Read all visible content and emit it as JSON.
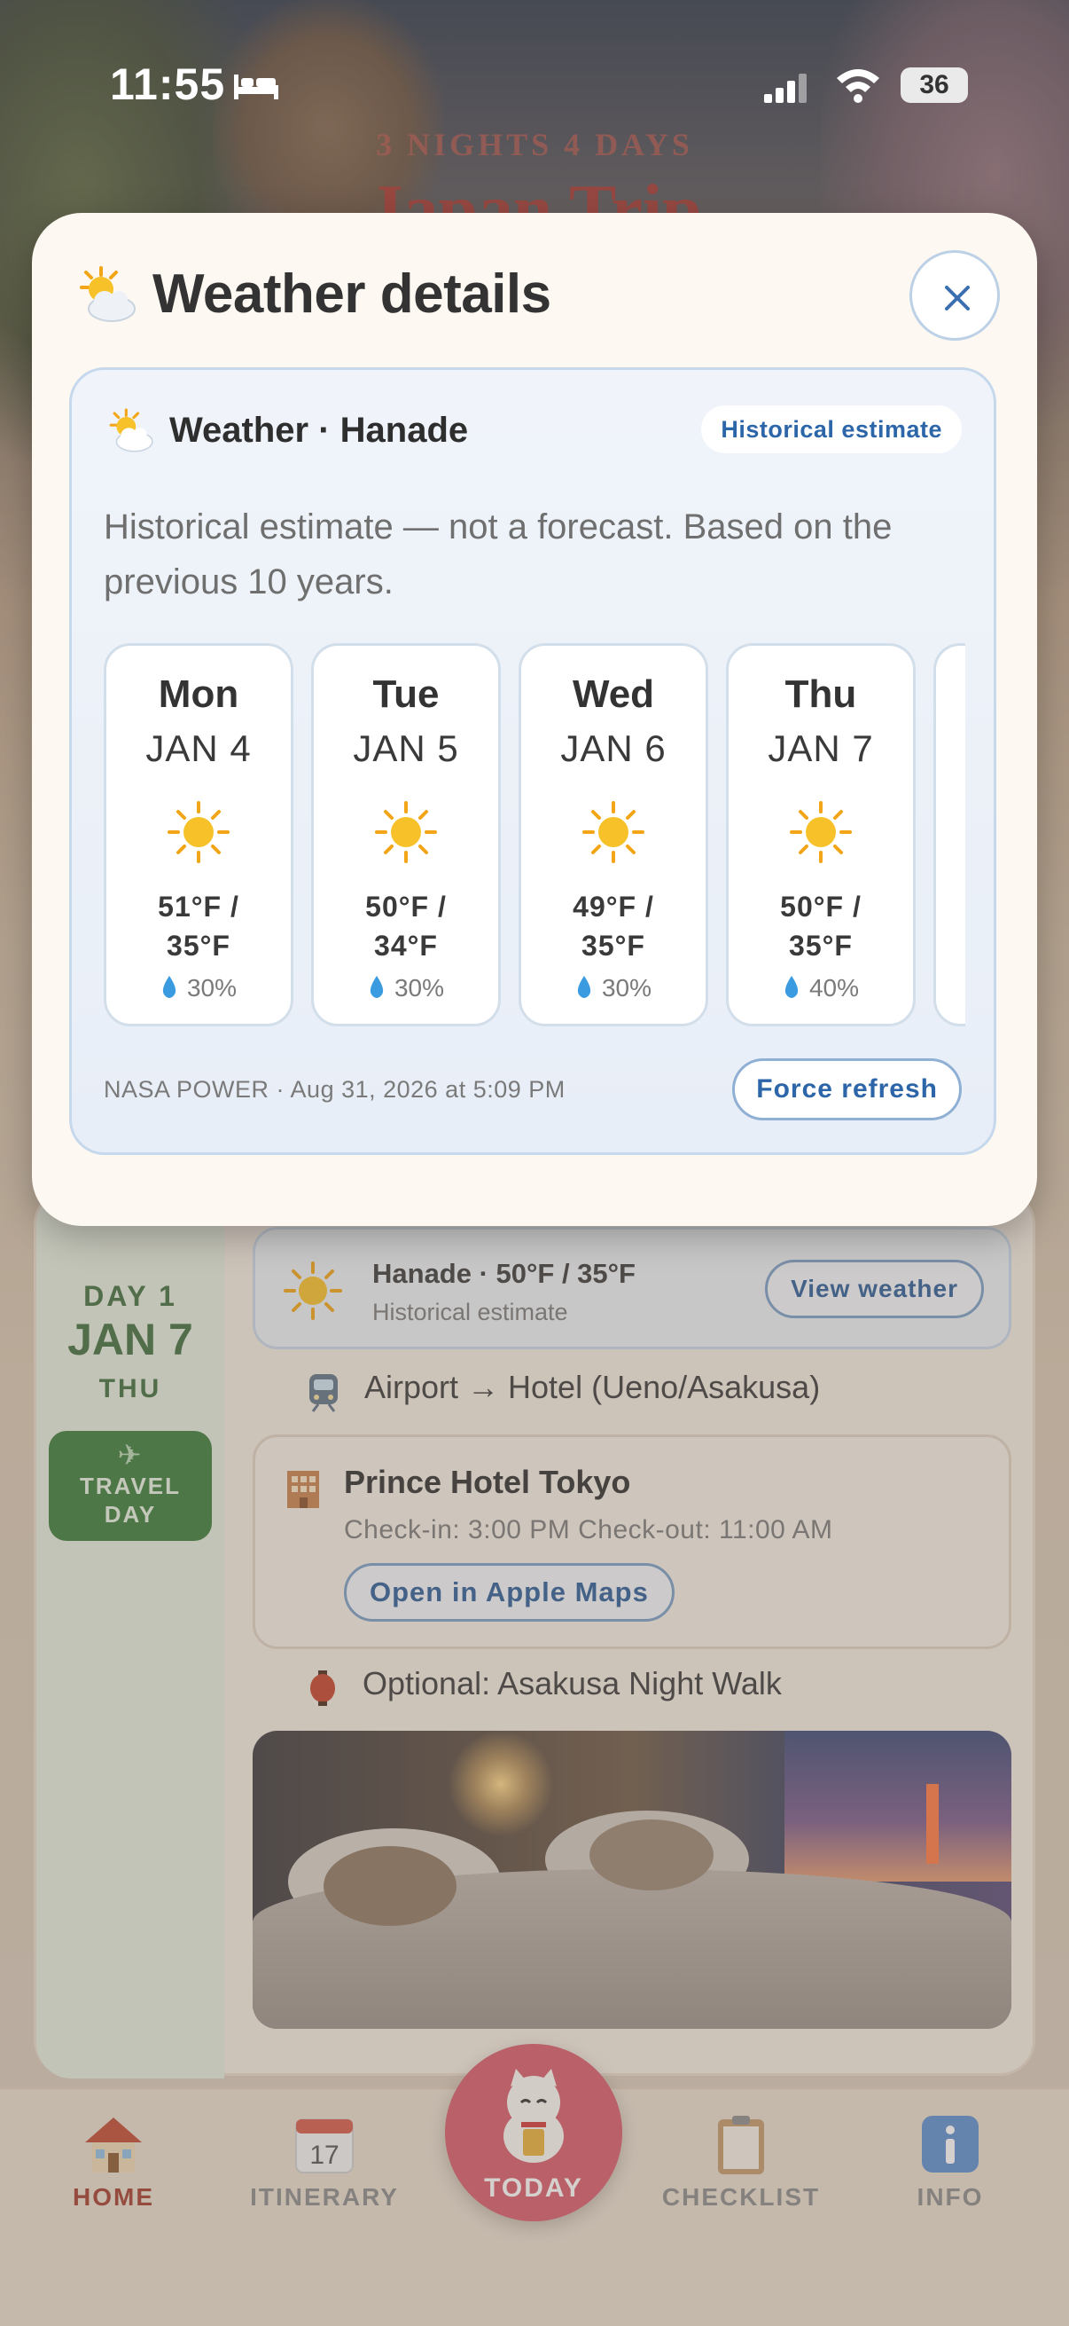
{
  "status_bar": {
    "time": "11:55",
    "battery": "36"
  },
  "background": {
    "subtitle": "3 NIGHTS 4 DAYS",
    "title": "Japan Trip"
  },
  "modal": {
    "title": "Weather details",
    "card": {
      "title": "Weather · Hanade",
      "badge": "Historical estimate",
      "disclaimer": "Historical estimate — not a forecast. Based on the previous 10 years.",
      "days": [
        {
          "dow": "Mon",
          "date": "JAN 4",
          "temp_line1": "51°F /",
          "temp_line2": "35°F",
          "precip": "30%"
        },
        {
          "dow": "Tue",
          "date": "JAN 5",
          "temp_line1": "50°F /",
          "temp_line2": "34°F",
          "precip": "30%"
        },
        {
          "dow": "Wed",
          "date": "JAN 6",
          "temp_line1": "49°F /",
          "temp_line2": "35°F",
          "precip": "30%"
        },
        {
          "dow": "Thu",
          "date": "JAN 7",
          "temp_line1": "50°F /",
          "temp_line2": "35°F",
          "precip": "40%"
        }
      ],
      "source": "NASA POWER · Aug 31, 2026 at 5:09 PM",
      "refresh_label": "Force refresh"
    }
  },
  "itinerary": {
    "day_label": "DAY 1",
    "day_date": "JAN 7",
    "day_dow": "THU",
    "travel_day": [
      "TRAVEL",
      "DAY"
    ],
    "weather_row": {
      "title": "Hanade · 50°F / 35°F",
      "subtitle": "Historical estimate",
      "button": "View weather"
    },
    "transit": "Airport → Hotel (Ueno/Asakusa)",
    "hotel": {
      "name": "Prince Hotel Tokyo",
      "times": "Check-in: 3:00 PM   Check-out: 11:00 AM",
      "maps_button": "Open in Apple Maps"
    },
    "optional": "Optional: Asakusa Night Walk"
  },
  "tabbar": {
    "home": "HOME",
    "itinerary": "ITINERARY",
    "itinerary_icon_day": "17",
    "today": "TODAY",
    "checklist": "CHECKLIST",
    "info": "INFO"
  },
  "colors": {
    "accent_blue": "#2d66a8",
    "home_red": "#a23d2f",
    "day_green": "#3f6d3d",
    "today_pink": "#d85a6a"
  }
}
